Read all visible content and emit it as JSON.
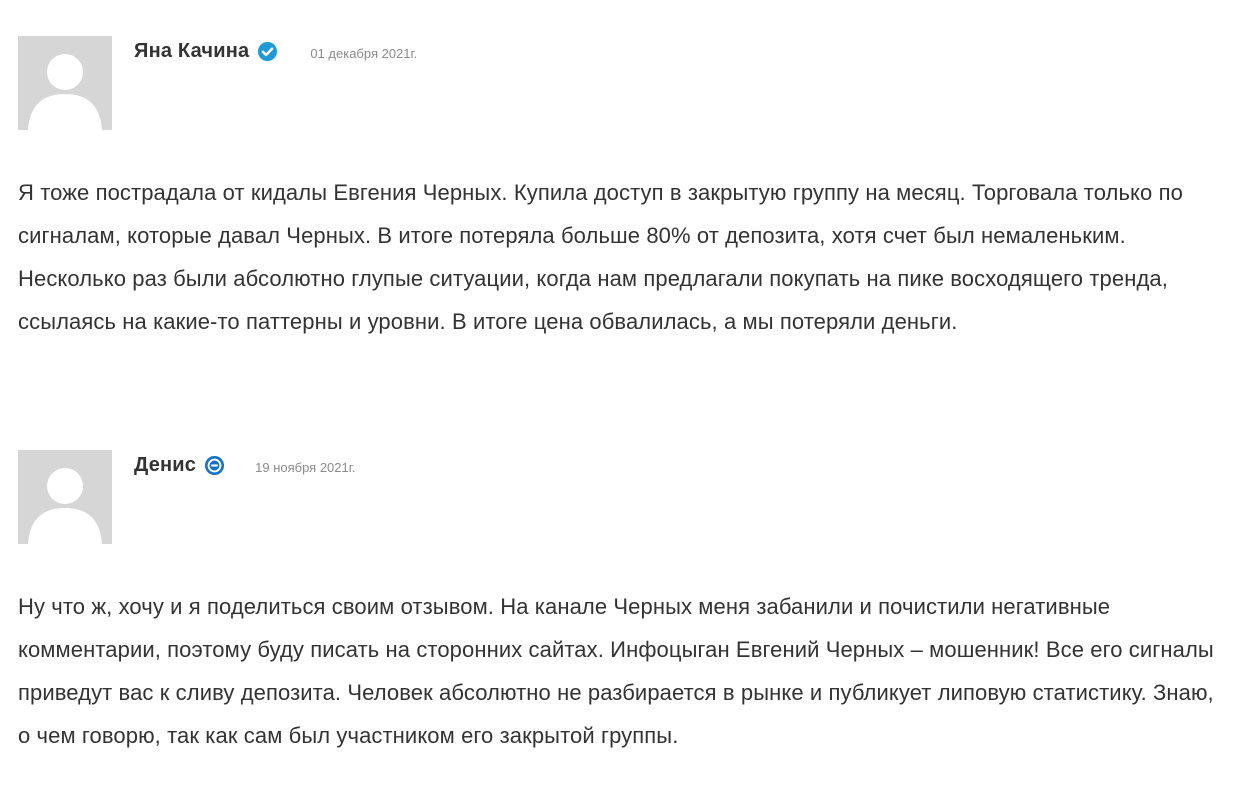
{
  "comments": [
    {
      "author": "Яна Качина",
      "badge_icon": "verified-check-icon",
      "badge_color": "#1e9bd7",
      "date": "01 декабря 2021г.",
      "text": "Я тоже пострадала от кидалы Евгения Черных. Купила доступ в закрытую группу на месяц. Торговала только по сигналам, которые давал Черных. В итоге потеряла больше 80% от депозита, хотя счет был немаленьким. Несколько раз были абсолютно глупые ситуации, когда нам предлагали покупать на пике восходящего тренда, ссылаясь на какие-то паттерны и уровни. В итоге цена обвалилась, а мы потеряли деньги."
    },
    {
      "author": "Денис",
      "badge_icon": "minus-circle-icon",
      "badge_color": "#1673c4",
      "date": "19 ноября 2021г.",
      "text": "Ну что ж, хочу и я поделиться своим отзывом. На канале Черных меня забанили и почистили негативные комментарии, поэтому буду писать на сторонних сайтах. Инфоцыган Евгений Черных – мошенник! Все его сигналы приведут вас к сливу депозита. Человек абсолютно не разбирается в рынке и публикует липовую статистику. Знаю, о чем говорю, так как сам был участником его закрытой группы."
    }
  ]
}
